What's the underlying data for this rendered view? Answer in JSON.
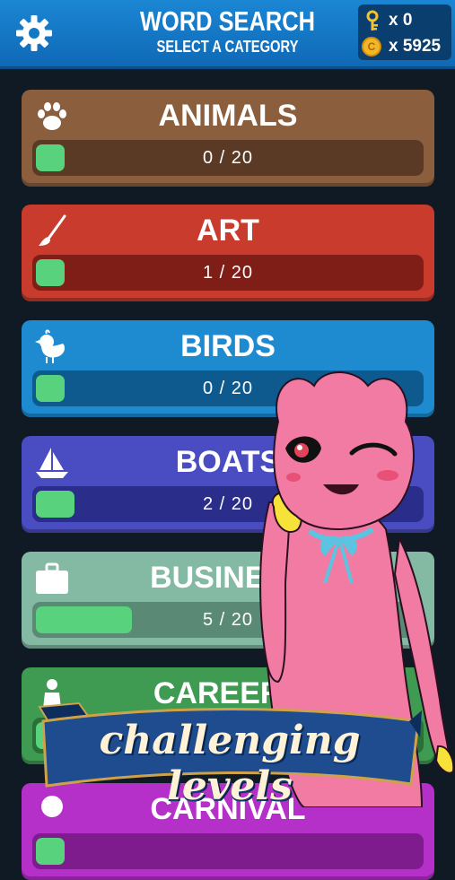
{
  "header": {
    "title": "WORD SEARCH",
    "subtitle": "SELECT A CATEGORY"
  },
  "wallet": {
    "keys": "x 0",
    "coins": "x 5925",
    "coin_glyph": "C"
  },
  "categories": [
    {
      "name": "ANIMALS",
      "progress": "0 / 20",
      "fraction": 0.0,
      "color": "#8b5f3e",
      "bar": "#5a3a24",
      "icon": "paw-icon"
    },
    {
      "name": "ART",
      "progress": "1 / 20",
      "fraction": 0.05,
      "color": "#c93b2c",
      "bar": "#7e1e16",
      "icon": "paintbrush-icon"
    },
    {
      "name": "BIRDS",
      "progress": "0 / 20",
      "fraction": 0.0,
      "color": "#1e8bd0",
      "bar": "#0e5a8f",
      "icon": "bird-icon"
    },
    {
      "name": "BOATS",
      "progress": "2 / 20",
      "fraction": 0.1,
      "color": "#4a4cc2",
      "bar": "#2b2d8a",
      "icon": "sailboat-icon"
    },
    {
      "name": "BUSINESS",
      "progress": "5 / 20",
      "fraction": 0.25,
      "color": "#84b9a4",
      "bar": "#5a8a76",
      "icon": "briefcase-icon"
    },
    {
      "name": "CAREERS",
      "progress": "",
      "fraction": 0.0,
      "color": "#3f9a52",
      "bar": "#2a6e38",
      "icon": "person-icon"
    },
    {
      "name": "CARNIVAL",
      "progress": "",
      "fraction": 0.0,
      "color": "#b430c8",
      "bar": "#7e1c8e",
      "icon": "carnival-icon"
    }
  ],
  "banner": {
    "text": "challenging levels"
  }
}
